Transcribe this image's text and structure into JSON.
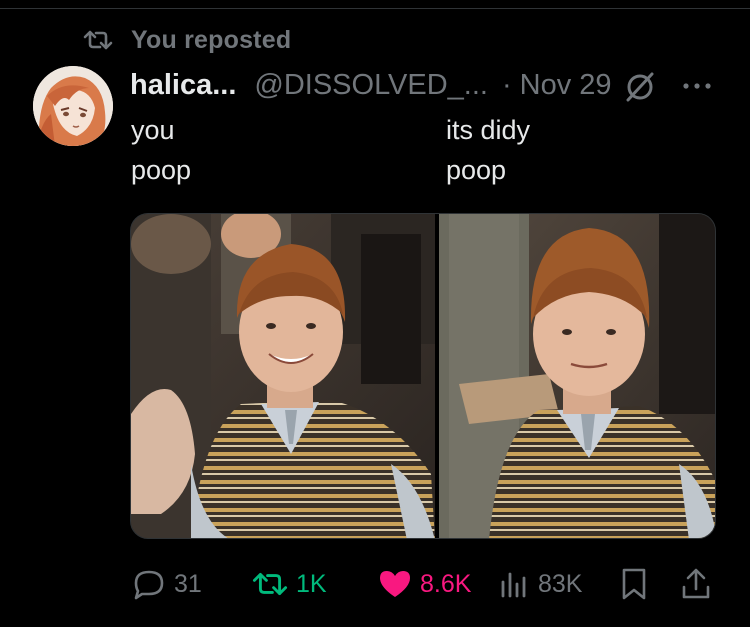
{
  "repost_banner": {
    "text": "You reposted"
  },
  "post": {
    "display_name": "halica...",
    "handle": "@DISSOLVED_...",
    "separator": "·",
    "date": "Nov 29",
    "captions": {
      "left": [
        "you",
        "poop"
      ],
      "right": [
        "its didy",
        "poop"
      ]
    }
  },
  "actions": {
    "replies": "31",
    "reposts": "1K",
    "likes": "8.6K",
    "views": "83K"
  },
  "colors": {
    "background": "#000000",
    "text": "#e7e9ea",
    "muted": "#71767b",
    "repost_active": "#00ba7c",
    "like_active": "#f91880"
  },
  "icons": [
    "repost-icon",
    "grok-icon",
    "more-icon",
    "reply-icon",
    "heart-icon",
    "views-icon",
    "bookmark-icon",
    "share-icon"
  ]
}
